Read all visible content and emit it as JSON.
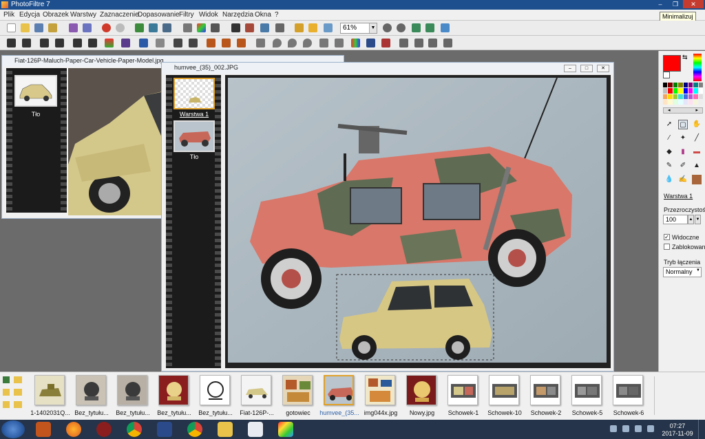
{
  "app": {
    "title": "PhotoFiltre 7",
    "tooltip": "Minimalizuj",
    "window_buttons": [
      "–",
      "❐",
      "✕"
    ]
  },
  "menu": [
    "Plik",
    "Edycja",
    "Obrazek",
    "Warstwy",
    "Zaznaczenie",
    "Dopasowanie",
    "Filtry",
    "Widok",
    "Narzędzia",
    "Okna",
    "?"
  ],
  "toolbar": {
    "zoom_value": "61%",
    "zoom_arrow": "▼"
  },
  "doc_fiat": {
    "title": "Fiat-126P-Maluch-Paper-Car-Vehicle-Paper-Model.jpg",
    "layers": [
      {
        "label": "Tło"
      }
    ]
  },
  "doc_humvee": {
    "title": "humvee_(35)_002.JPG",
    "layers": [
      {
        "label": "Warstwa 1",
        "selected": true
      },
      {
        "label": "Tło",
        "selected": false
      }
    ],
    "buttons": [
      "–",
      "□",
      "✕"
    ]
  },
  "right_panel": {
    "layer_name": "Warstwa 1",
    "opacity_label": "Przezroczystość",
    "opacity_value": "100",
    "visible_label": "Widoczne",
    "visible_checked": true,
    "locked_label": "Zablokowane",
    "locked_checked": false,
    "blend_label": "Tryb łączenia",
    "blend_value": "Normalny",
    "foreground_color": "#ff0000",
    "background_color": "#ffffff",
    "stepper_up": "▲",
    "stepper_down": "▼",
    "dropdown_arrow": "▼",
    "nav_prev": "◂",
    "nav_next": "▸",
    "swap_icon": "⇆",
    "check_mark": "✓"
  },
  "image_strip": [
    {
      "label": "1-1402031Q...",
      "selected": false
    },
    {
      "label": "Bez_tytułu...",
      "selected": false
    },
    {
      "label": "Bez_tytułu...",
      "selected": false
    },
    {
      "label": "Bez_tytułu...",
      "selected": false
    },
    {
      "label": "Bez_tytułu...",
      "selected": false
    },
    {
      "label": "Fiat-126P-...",
      "selected": false
    },
    {
      "label": "gotowiec",
      "selected": false
    },
    {
      "label": "humvee_(35...",
      "selected": true
    },
    {
      "label": "img044x.jpg",
      "selected": false
    },
    {
      "label": "Nowy.jpg",
      "selected": false
    },
    {
      "label": "Schowek-1",
      "selected": false
    },
    {
      "label": "Schowek-10",
      "selected": false
    },
    {
      "label": "Schowek-2",
      "selected": false
    },
    {
      "label": "Schowek-5",
      "selected": false
    },
    {
      "label": "Schowek-6",
      "selected": false
    }
  ],
  "taskbar": {
    "time": "07:27",
    "date": "2017-11-09"
  },
  "colors": {
    "accent": "#e0a12a",
    "titlebar": "#1d4f8f",
    "taskbar": "#25344a"
  }
}
